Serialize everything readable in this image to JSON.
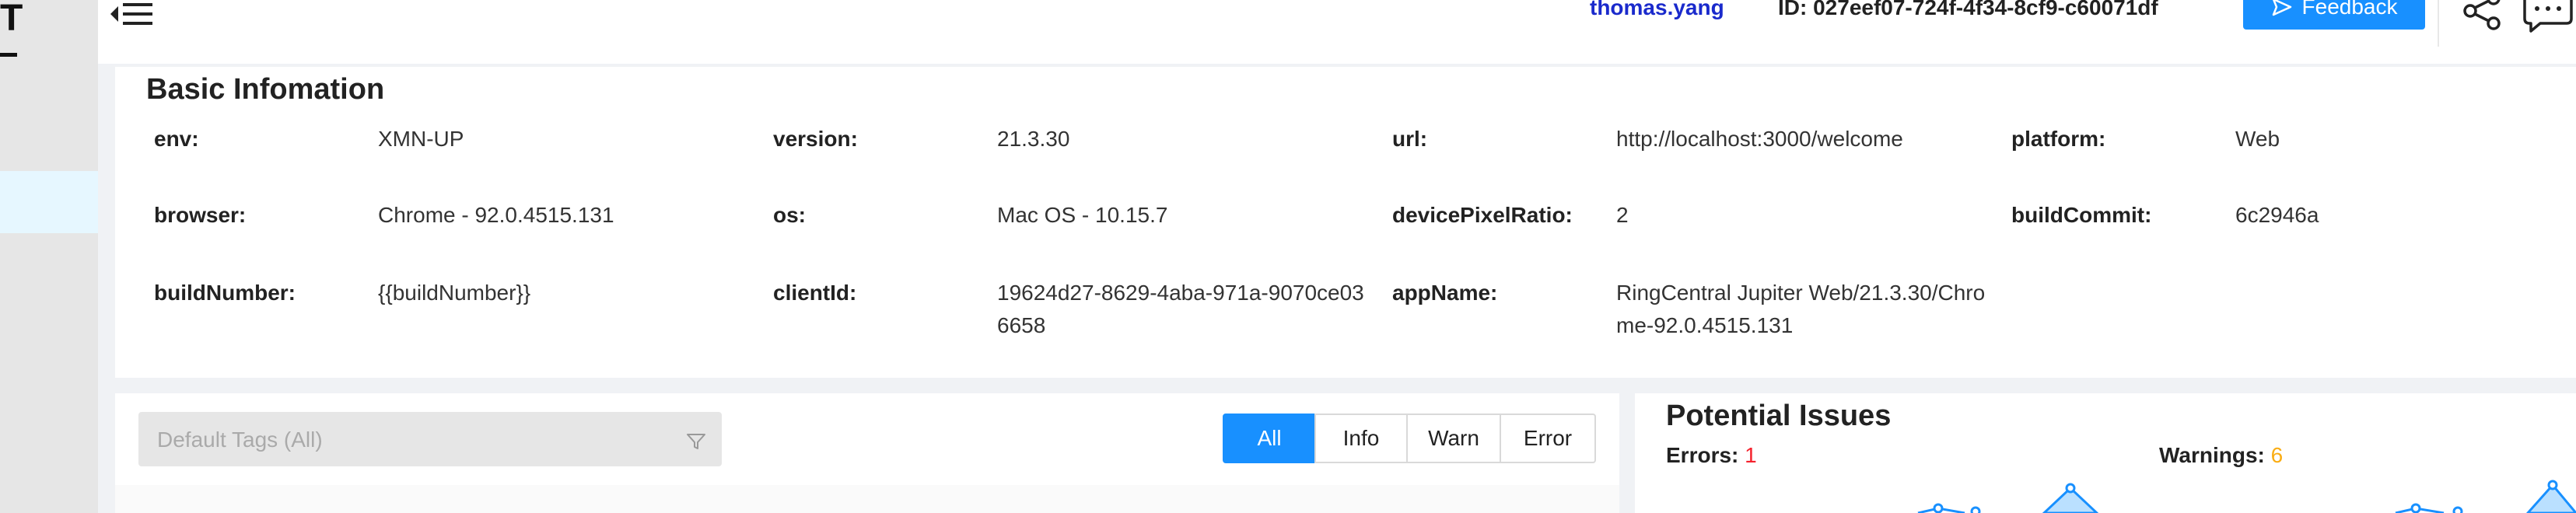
{
  "sidebar": {
    "logo_text": "T"
  },
  "header": {
    "username": "thomas.yang",
    "session_id": "ID: 027eef07-724f-4f34-8cf9-c60071df",
    "feedback_label": "Feedback"
  },
  "basic_info": {
    "title": "Basic Infomation",
    "fields": [
      {
        "label": "env:",
        "value": "XMN-UP"
      },
      {
        "label": "version:",
        "value": "21.3.30"
      },
      {
        "label": "url:",
        "value": "http://localhost:3000/welcome"
      },
      {
        "label": "platform:",
        "value": "Web"
      },
      {
        "label": "browser:",
        "value": "Chrome - 92.0.4515.131"
      },
      {
        "label": "os:",
        "value": "Mac OS - 10.15.7"
      },
      {
        "label": "devicePixelRatio:",
        "value": "2"
      },
      {
        "label": "buildCommit:",
        "value": "6c2946a"
      },
      {
        "label": "buildNumber:",
        "value": "{{buildNumber}}"
      },
      {
        "label": "clientId:",
        "value": "19624d27-8629-4aba-971a-9070ce036658"
      },
      {
        "label": "appName:",
        "value": "RingCentral Jupiter Web/21.3.30/Chrome-92.0.4515.131"
      }
    ]
  },
  "logs": {
    "tag_placeholder": "Default Tags (All)",
    "levels": [
      "All",
      "Info",
      "Warn",
      "Error"
    ],
    "active_level": "All"
  },
  "issues": {
    "title": "Potential Issues",
    "errors_label": "Errors:",
    "errors_count": "1",
    "warnings_label": "Warnings:",
    "warnings_count": "6"
  },
  "colors": {
    "accent": "#1890ff",
    "error": "#f5222d",
    "warning": "#faad14",
    "username": "#1a2acc"
  },
  "icons": [
    "menu-fold-icon",
    "send-icon",
    "share-icon",
    "chat-icon",
    "filter-icon"
  ]
}
